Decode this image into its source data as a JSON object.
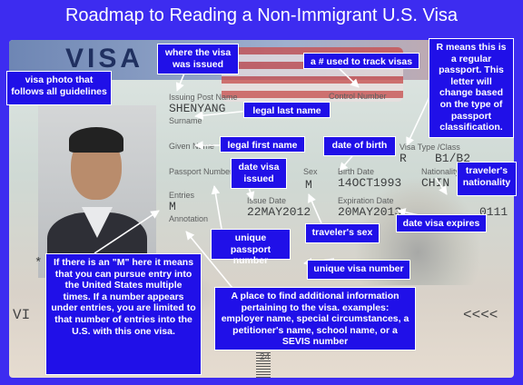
{
  "title": "Roadmap to Reading a Non-Immigrant U.S. Visa",
  "visa": {
    "visa_word": "VISA",
    "issuing_post_label": "Issuing Post Name",
    "issuing_post_value": "SHENYANG",
    "surname_label": "Surname",
    "given_name_label": "Given Name",
    "passport_number_label": "Passport Number",
    "entries_label": "Entries",
    "entries_value": "M",
    "annotation_label": "Annotation",
    "control_number_label": "Control Number",
    "visa_type_label": "Visa Type /Class",
    "visa_type_value": "R    B1/B2",
    "sex_label": "Sex",
    "sex_value": "M",
    "birth_date_label": "Birth Date",
    "birth_date_value": "14OCT1993",
    "nationality_label": "Nationality",
    "nationality_value": "CHIN",
    "issue_date_label": "Issue Date",
    "issue_date_value": "22MAY2012",
    "expiration_date_label": "Expiration Date",
    "expiration_date_value": "20MAY2013",
    "visa_number_fragment": "0111",
    "mrz_left": "VI",
    "mrz_right": "<<<<",
    "star": "*",
    "barcode_digits": "24"
  },
  "callouts": {
    "photo": "visa photo that follows all guidelines",
    "issued_where": "where the visa was issued",
    "control": "a # used to track visas",
    "visa_type": "R means this is a regular passport. This letter will change based on the type of passport classification.",
    "last_name": "legal last name",
    "first_name": "legal first name",
    "date_of_birth": "date of birth",
    "date_issued": "date visa issued",
    "nationality": "traveler's nationality",
    "expires": "date visa expires",
    "passport_number": "unique passport number",
    "sex": "traveler's sex",
    "visa_number": "unique visa number",
    "entries": "If there is an \"M\" here it means that you can pursue entry into the United States multiple times. If a number appears under entries, you are limited to that number of entries into the U.S. with this one visa.",
    "annotation": "A place to find additional information pertaining to the visa. examples: employer name, special circumstances, a petitioner's name, school name, or a SEVIS number"
  }
}
